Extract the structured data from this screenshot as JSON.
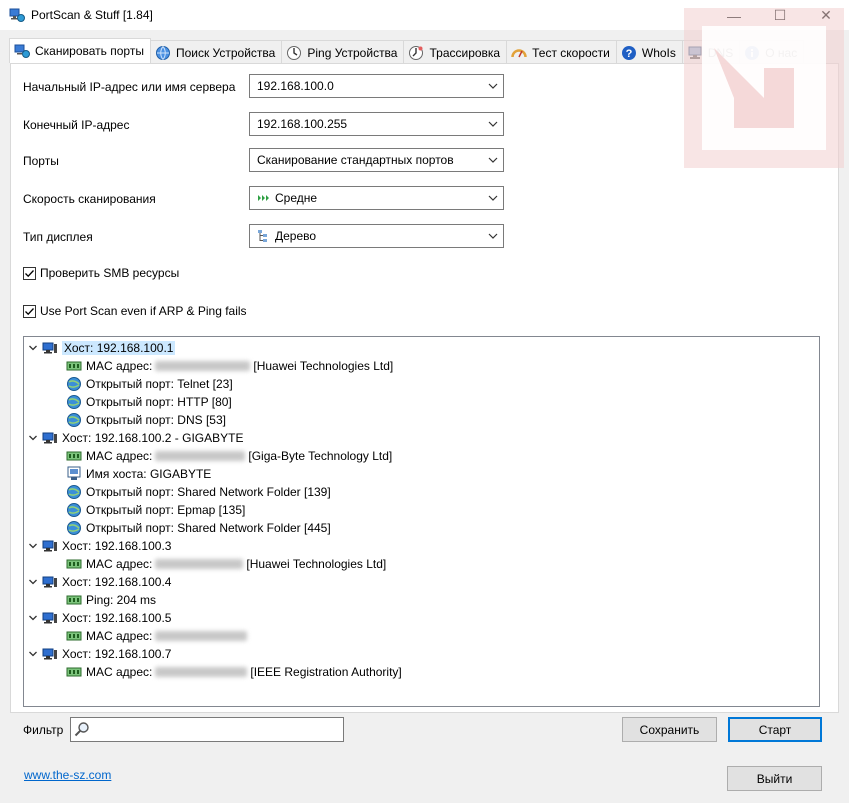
{
  "window": {
    "title": "PortScan & Stuff [1.84]",
    "minimize_glyph": "—",
    "maximize_glyph": "☐",
    "close_glyph": "✕"
  },
  "tabs": [
    {
      "label": "Сканировать порты",
      "icon": "scan-ports-icon",
      "active": true
    },
    {
      "label": "Поиск Устройства",
      "icon": "device-search-icon",
      "active": false
    },
    {
      "label": "Ping Устройства",
      "icon": "ping-icon",
      "active": false
    },
    {
      "label": "Трассировка",
      "icon": "traceroute-icon",
      "active": false
    },
    {
      "label": "Тест скорости",
      "icon": "speedtest-icon",
      "active": false
    },
    {
      "label": "WhoIs",
      "icon": "whois-icon",
      "active": false
    },
    {
      "label": "DNS",
      "icon": "dns-icon",
      "active": false
    },
    {
      "label": "О нас",
      "icon": "info-icon",
      "active": false
    }
  ],
  "form": {
    "start_ip_label": "Начальный IP-адрес или имя сервера",
    "start_ip_value": "192.168.100.0",
    "end_ip_label": "Конечный IP-адрес",
    "end_ip_value": "192.168.100.255",
    "ports_label": "Порты",
    "ports_value": "Сканирование стандартных портов",
    "speed_label": "Скорость сканирования",
    "speed_value": "Средне",
    "display_label": "Тип дисплея",
    "display_value": "Дерево",
    "smb_label": "Проверить SMB ресурсы",
    "smb_checked": true,
    "arp_label": "Use Port Scan even if ARP & Ping fails",
    "arp_checked": true
  },
  "tree": {
    "hosts": [
      {
        "label": "Хост: 192.168.100.1",
        "selected": true,
        "children": [
          {
            "icon": "mac-icon",
            "prefix": "MAC адрес:",
            "blurred": true,
            "suffix": "[Huawei Technologies Ltd]"
          },
          {
            "icon": "port-icon",
            "text": "Открытый порт: Telnet [23]"
          },
          {
            "icon": "port-icon",
            "text": "Открытый порт: HTTP [80]"
          },
          {
            "icon": "port-icon",
            "text": "Открытый порт: DNS [53]"
          }
        ]
      },
      {
        "label": "Хост: 192.168.100.2 - GIGABYTE",
        "selected": false,
        "children": [
          {
            "icon": "mac-icon",
            "prefix": "MAC адрес:",
            "blurred": true,
            "suffix": "[Giga-Byte Technology Ltd]"
          },
          {
            "icon": "hostname-icon",
            "text": "Имя хоста: GIGABYTE"
          },
          {
            "icon": "port-icon",
            "text": "Открытый порт: Shared Network Folder [139]"
          },
          {
            "icon": "port-icon",
            "text": "Открытый порт: Epmap [135]"
          },
          {
            "icon": "port-icon",
            "text": "Открытый порт: Shared Network Folder [445]"
          }
        ]
      },
      {
        "label": "Хост: 192.168.100.3",
        "selected": false,
        "children": [
          {
            "icon": "mac-icon",
            "prefix": "MAC адрес:",
            "blurred": true,
            "suffix": "[Huawei Technologies Ltd]"
          }
        ]
      },
      {
        "label": "Хост: 192.168.100.4",
        "selected": false,
        "children": [
          {
            "icon": "mac-icon",
            "text": "Ping: 204 ms"
          }
        ]
      },
      {
        "label": "Хост: 192.168.100.5",
        "selected": false,
        "children": [
          {
            "icon": "mac-icon",
            "prefix": "MAC адрес:",
            "blurred": true,
            "suffix": ""
          }
        ]
      },
      {
        "label": "Хост: 192.168.100.7",
        "selected": false,
        "children": [
          {
            "icon": "mac-icon",
            "prefix": "MAC адрес:",
            "blurred": true,
            "suffix": "[IEEE Registration Authority]"
          }
        ]
      }
    ]
  },
  "bottom": {
    "filter_label": "Фильтр",
    "filter_value": "",
    "save_label": "Сохранить",
    "start_label": "Старт",
    "website_link": "www.the-sz.com",
    "exit_label": "Выйти"
  },
  "colors": {
    "selection": "#cce8ff",
    "default_button_border": "#0078d7",
    "link": "#0066cc",
    "watermark": "#f3d0d0"
  }
}
